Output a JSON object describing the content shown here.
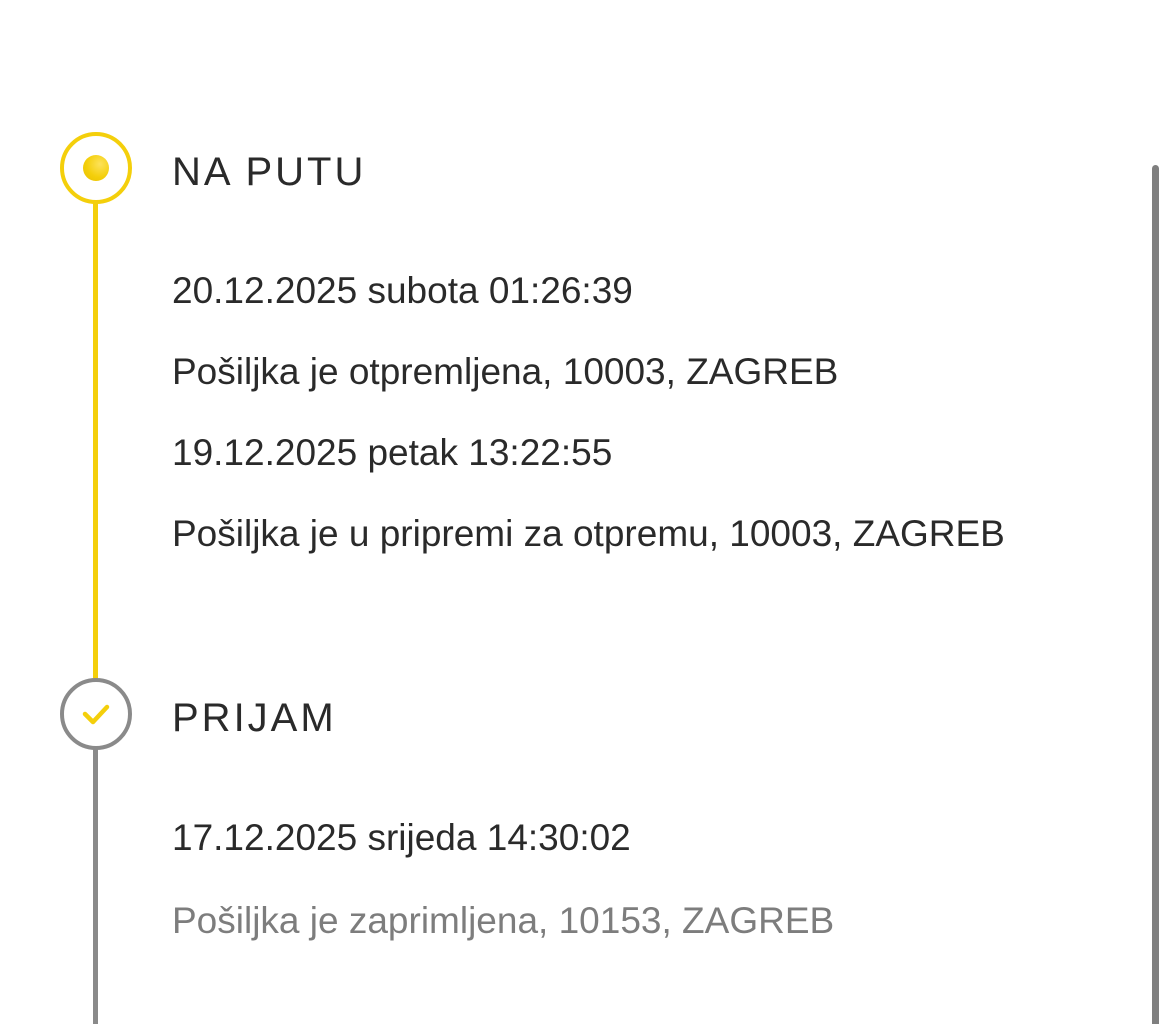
{
  "timeline": {
    "sections": [
      {
        "status": "NA PUTU",
        "state": "active",
        "events": [
          {
            "datetime": "20.12.2025 subota 01:26:39",
            "description": "Pošiljka je otpremljena, 10003, ZAGREB"
          },
          {
            "datetime": "19.12.2025 petak 13:22:55",
            "description": "Pošiljka je u pripremi za otpremu, 10003, ZAGREB"
          }
        ]
      },
      {
        "status": "PRIJAM",
        "state": "completed",
        "events": [
          {
            "datetime": "17.12.2025 srijeda 14:30:02",
            "description": "Pošiljka je zaprimljena, 10153, ZAGREB"
          }
        ]
      }
    ]
  },
  "colors": {
    "accent": "#f4cf0b",
    "completed": "#8a8a8a",
    "text": "#2a2a2a",
    "muted_text": "#7d7d7d",
    "background": "#ffffff"
  },
  "icons": {
    "active_marker": "in-progress-dot-icon",
    "completed_marker": "checkmark-icon"
  }
}
